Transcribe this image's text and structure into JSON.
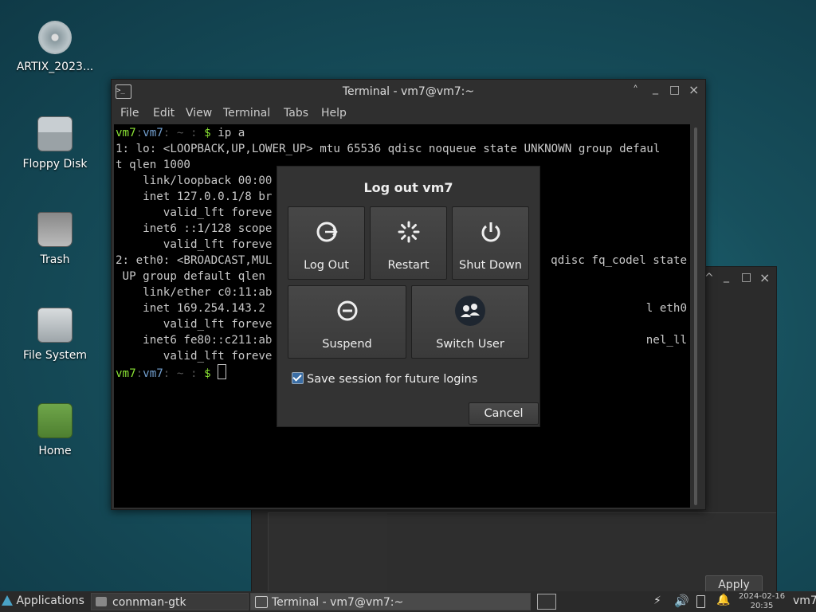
{
  "desktop": {
    "icons": [
      {
        "label": "ARTIX_2023...",
        "icon": "disc-icon"
      },
      {
        "label": "Floppy Disk",
        "icon": "floppy-icon"
      },
      {
        "label": "Trash",
        "icon": "trash-icon"
      },
      {
        "label": "File System",
        "icon": "drive-icon"
      },
      {
        "label": "Home",
        "icon": "home-folder-icon"
      }
    ]
  },
  "background_window": {
    "controls": [
      "^",
      "_",
      "□",
      "×"
    ],
    "apply_label": "Apply"
  },
  "terminal": {
    "title": "Terminal - vm7@vm7:~",
    "menu": [
      "File",
      "Edit",
      "View",
      "Terminal",
      "Tabs",
      "Help"
    ],
    "prompt_user": "vm7",
    "prompt_host": "vm7",
    "prompt_path": "~",
    "command": "ip a",
    "output": [
      "1: lo: <LOOPBACK,UP,LOWER_UP> mtu 65536 qdisc noqueue state UNKNOWN group defaul",
      "t qlen 1000",
      "    link/loopback 00:00",
      "    inet 127.0.0.1/8 br",
      "       valid_lft foreve",
      "    inet6 ::1/128 scope",
      "       valid_lft foreve",
      "2: eth0: <BROADCAST,MUL",
      " UP group default qlen",
      "    link/ether c0:11:ab",
      "    inet 169.254.143.2",
      "       valid_lft foreve",
      "    inet6 fe80::c211:ab",
      "       valid_lft foreve"
    ],
    "output_right": [
      {
        "row": 7,
        "text": "qdisc fq_codel state"
      },
      {
        "row": 10,
        "text": "l eth0"
      },
      {
        "row": 12,
        "text": "nel_ll"
      }
    ]
  },
  "dialog": {
    "title": "Log out vm7",
    "actions": [
      {
        "label": "Log Out",
        "icon": "logout-icon"
      },
      {
        "label": "Restart",
        "icon": "restart-icon"
      },
      {
        "label": "Shut Down",
        "icon": "power-icon"
      },
      {
        "label": "Suspend",
        "icon": "suspend-icon"
      },
      {
        "label": "Switch User",
        "icon": "switch-user-icon"
      }
    ],
    "save_session_label": "Save session for future logins",
    "save_session_checked": true,
    "cancel_label": "Cancel"
  },
  "taskbar": {
    "applications_label": "Applications",
    "tasks": [
      "connman-gtk",
      "Terminal - vm7@vm7:~"
    ],
    "date": "2024-02-16",
    "time": "20:35",
    "user": "vm7"
  }
}
